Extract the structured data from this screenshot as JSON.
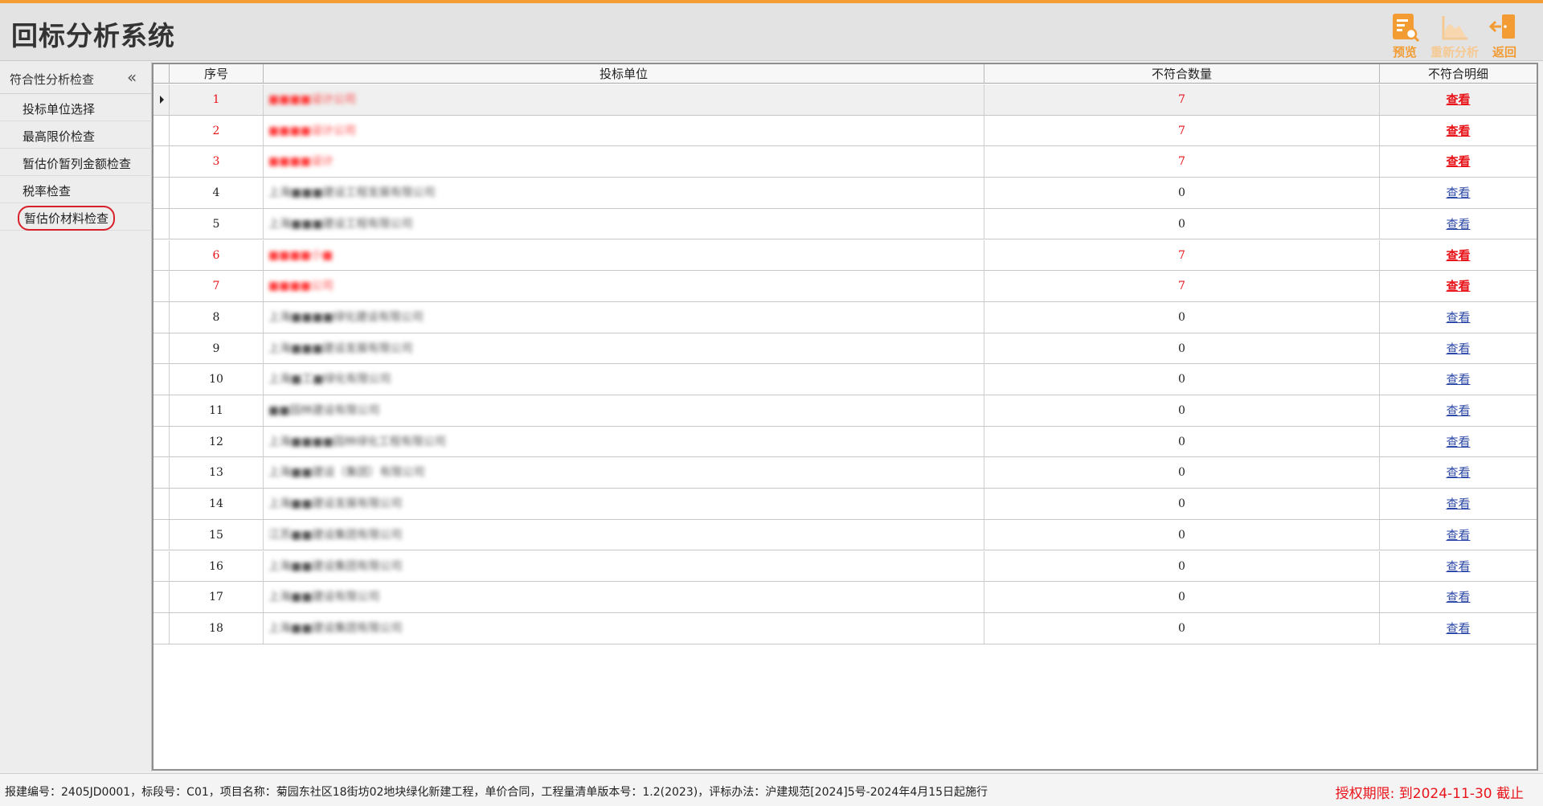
{
  "app": {
    "title": "回标分析系统"
  },
  "toolbar": {
    "preview_label": "预览",
    "reanalyze_label": "重新分析",
    "back_label": "返回",
    "accent_color": "#f39c34"
  },
  "sidebar": {
    "title": "符合性分析检查",
    "collapse_icon": "double-chevron-left-icon",
    "items": [
      {
        "label": "投标单位选择"
      },
      {
        "label": "最高限价检查"
      },
      {
        "label": "暂估价暂列金额检查"
      },
      {
        "label": "税率检查"
      },
      {
        "label": "暂估价材料检查"
      }
    ]
  },
  "table": {
    "columns": [
      "序号",
      "投标单位",
      "不符合数量",
      "不符合明细"
    ],
    "rows": [
      {
        "no": "1",
        "unit": "■■■■设计公司",
        "count": "7",
        "detail": "查看",
        "flag": "red"
      },
      {
        "no": "2",
        "unit": "■■■■设计公司",
        "count": "7",
        "detail": "查看",
        "flag": "red"
      },
      {
        "no": "3",
        "unit": "■■■■设计",
        "count": "7",
        "detail": "查看",
        "flag": "red"
      },
      {
        "no": "4",
        "unit": "上海■■■建设工程发展有限公司",
        "count": "0",
        "detail": "查看",
        "flag": "normal"
      },
      {
        "no": "5",
        "unit": "上海■■■建设工程有限公司",
        "count": "0",
        "detail": "查看",
        "flag": "normal"
      },
      {
        "no": "6",
        "unit": "■■■■小■",
        "count": "7",
        "detail": "查看",
        "flag": "red"
      },
      {
        "no": "7",
        "unit": "■■■■公司",
        "count": "7",
        "detail": "查看",
        "flag": "red"
      },
      {
        "no": "8",
        "unit": "上海■■■■绿化建设有限公司",
        "count": "0",
        "detail": "查看",
        "flag": "normal"
      },
      {
        "no": "9",
        "unit": "上海■■■建设发展有限公司",
        "count": "0",
        "detail": "查看",
        "flag": "normal"
      },
      {
        "no": "10",
        "unit": "上海■工■绿化有限公司",
        "count": "0",
        "detail": "查看",
        "flag": "normal"
      },
      {
        "no": "11",
        "unit": "■■园林建设有限公司",
        "count": "0",
        "detail": "查看",
        "flag": "normal"
      },
      {
        "no": "12",
        "unit": "上海■■■■园林绿化工程有限公司",
        "count": "0",
        "detail": "查看",
        "flag": "normal"
      },
      {
        "no": "13",
        "unit": "上海■■建设（集团）有限公司",
        "count": "0",
        "detail": "查看",
        "flag": "normal"
      },
      {
        "no": "14",
        "unit": "上海■■建设发展有限公司",
        "count": "0",
        "detail": "查看",
        "flag": "normal"
      },
      {
        "no": "15",
        "unit": "江苏■■建设集团有限公司",
        "count": "0",
        "detail": "查看",
        "flag": "normal"
      },
      {
        "no": "16",
        "unit": "上海■■建设集团有限公司",
        "count": "0",
        "detail": "查看",
        "flag": "normal"
      },
      {
        "no": "17",
        "unit": "上海■■建设有限公司",
        "count": "0",
        "detail": "查看",
        "flag": "normal"
      },
      {
        "no": "18",
        "unit": "上海■■建设集团有限公司",
        "count": "0",
        "detail": "查看",
        "flag": "normal"
      }
    ]
  },
  "status": {
    "info": "报建编号：2405JD0001，标段号：C01，项目名称：菊园东社区18街坊02地块绿化新建工程，单价合同，工程量清单版本号：1.2(2023)，评标办法：沪建规范[2024]5号-2024年4月15日起施行",
    "license": "授权期限: 到2024-11-30 截止"
  },
  "colors": {
    "mismatch": "#e8141a",
    "link": "#2c48a8"
  }
}
